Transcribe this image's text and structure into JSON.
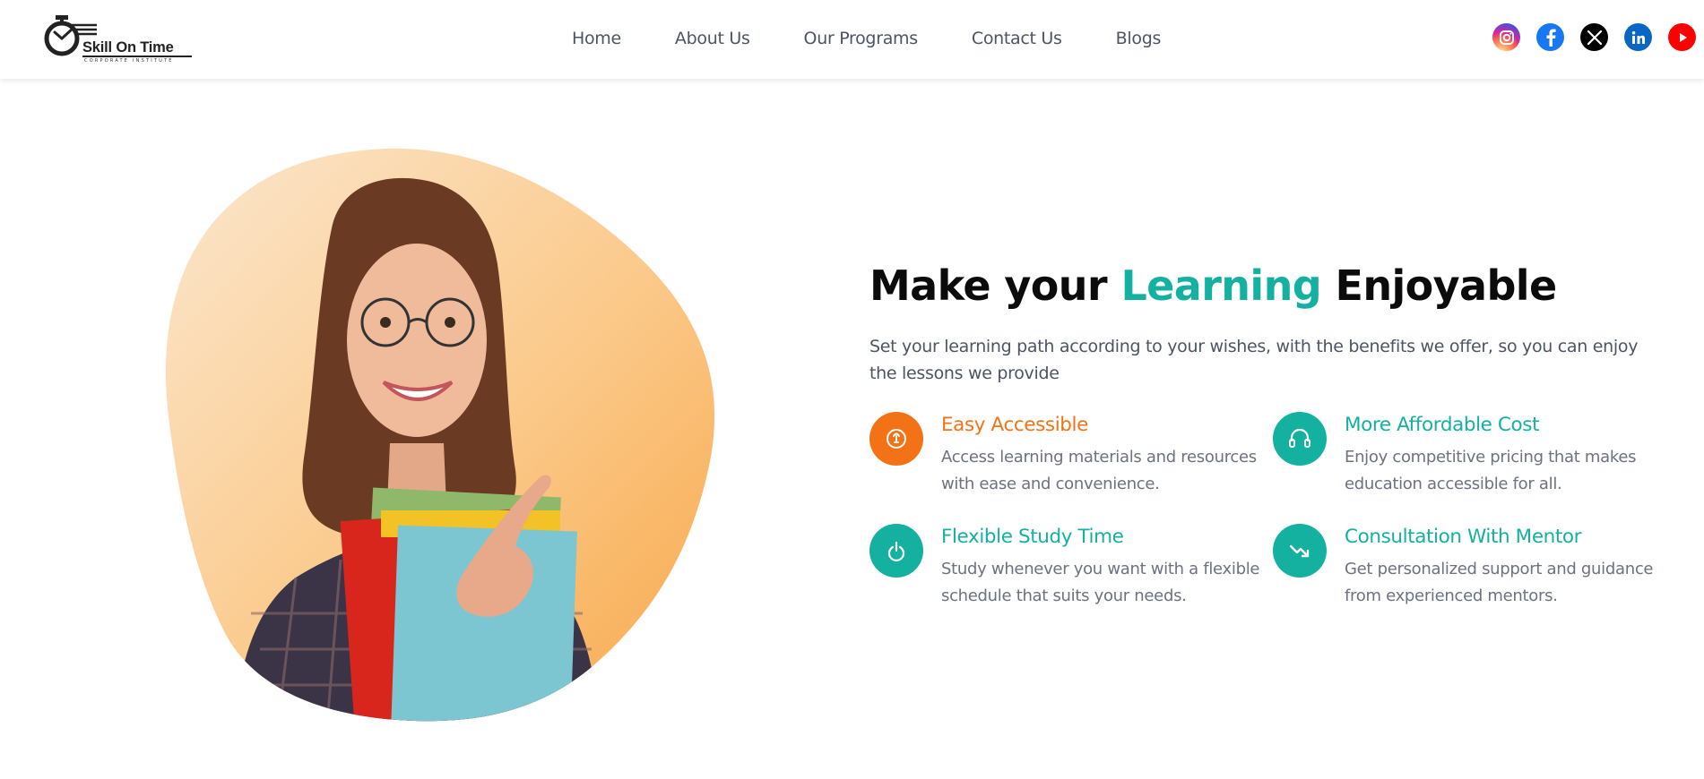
{
  "brand": {
    "name": "Skill On Time",
    "tagline": "CORPORATE INSTITUTE"
  },
  "nav": {
    "items": [
      "Home",
      "About Us",
      "Our Programs",
      "Contact Us",
      "Blogs"
    ]
  },
  "social": {
    "icons": [
      "instagram-icon",
      "facebook-icon",
      "x-icon",
      "linkedin-icon",
      "youtube-icon"
    ]
  },
  "hero": {
    "headline_before": "Make your ",
    "headline_accent": "Learning",
    "headline_after": " Enjoyable",
    "intro": "Set your learning path according to your wishes, with the benefits we offer, so you can enjoy the lessons we provide"
  },
  "features": [
    {
      "title": "Easy Accessible",
      "desc": "Access learning materials and resources with ease and convenience.",
      "color": "#f47216",
      "icon": "bulb-icon"
    },
    {
      "title": "More Affordable Cost",
      "desc": "Enjoy competitive pricing that makes education accessible for all.",
      "color": "#14b1a0",
      "icon": "headset-icon"
    },
    {
      "title": "Flexible Study Time",
      "desc": "Study whenever you want with a flexible schedule that suits your needs.",
      "color": "#14b1a0",
      "icon": "power-icon"
    },
    {
      "title": "Consultation With Mentor",
      "desc": "Get personalized support and guidance from experienced mentors.",
      "color": "#14b1a0",
      "icon": "trend-down-icon"
    }
  ],
  "colors": {
    "accent": "#14b1a0",
    "orange": "#f47216",
    "text": "#4b5563"
  }
}
